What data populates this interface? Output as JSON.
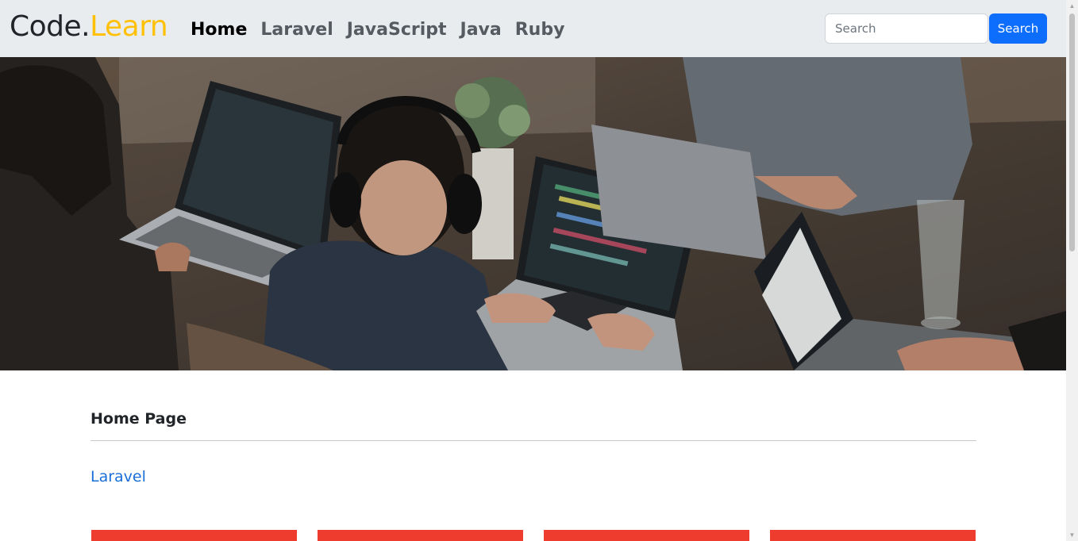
{
  "brand": {
    "part1": "Code.",
    "part2": "Learn"
  },
  "nav": {
    "items": [
      {
        "label": "Home",
        "active": true
      },
      {
        "label": "Laravel",
        "active": false
      },
      {
        "label": "JavaScript",
        "active": false
      },
      {
        "label": "Java",
        "active": false
      },
      {
        "label": "Ruby",
        "active": false
      }
    ]
  },
  "search": {
    "placeholder": "Search",
    "value": "",
    "button_label": "Search"
  },
  "hero": {
    "icon": "hero-photo-people-coding-on-laptops"
  },
  "main": {
    "heading": "Home Page",
    "category_link": "Laravel",
    "card_count_visible": 4
  },
  "colors": {
    "navbar_bg": "#e9ecef",
    "brand_accent": "#ffc107",
    "primary": "#0d6efd",
    "link": "#1a6fd8",
    "card": "#ee3d2e"
  },
  "scrollbar": {
    "up_icon": "▲",
    "down_icon": "▼"
  }
}
